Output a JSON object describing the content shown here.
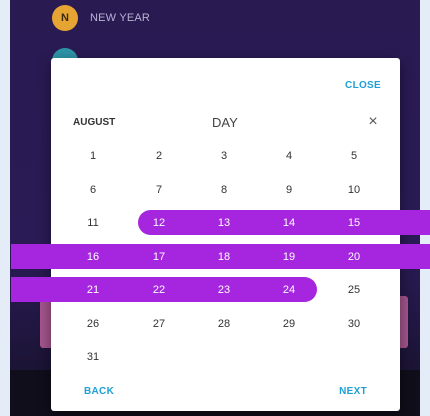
{
  "background": {
    "items": [
      {
        "avatar_letter": "N",
        "avatar_color": "#e6a432",
        "label": "NEW YEAR"
      },
      {
        "avatar_letter": "",
        "avatar_color": "#2f95a8",
        "label": ""
      }
    ],
    "accent_color": "#a4558d"
  },
  "dialog": {
    "close_label": "CLOSE",
    "month_label": "AUGUST",
    "mode_label": "DAY",
    "close_icon": "×",
    "back_label": "BACK",
    "next_label": "NEXT",
    "selection_color": "#a626df",
    "link_color": "#1e9fd6",
    "days": [
      "1",
      "2",
      "3",
      "4",
      "5",
      "6",
      "7",
      "8",
      "9",
      "10",
      "11",
      "12",
      "13",
      "14",
      "15",
      "16",
      "17",
      "18",
      "19",
      "20",
      "21",
      "22",
      "23",
      "24",
      "25",
      "26",
      "27",
      "28",
      "29",
      "30",
      "31"
    ],
    "selected_range": {
      "start": 12,
      "end": 24
    }
  }
}
